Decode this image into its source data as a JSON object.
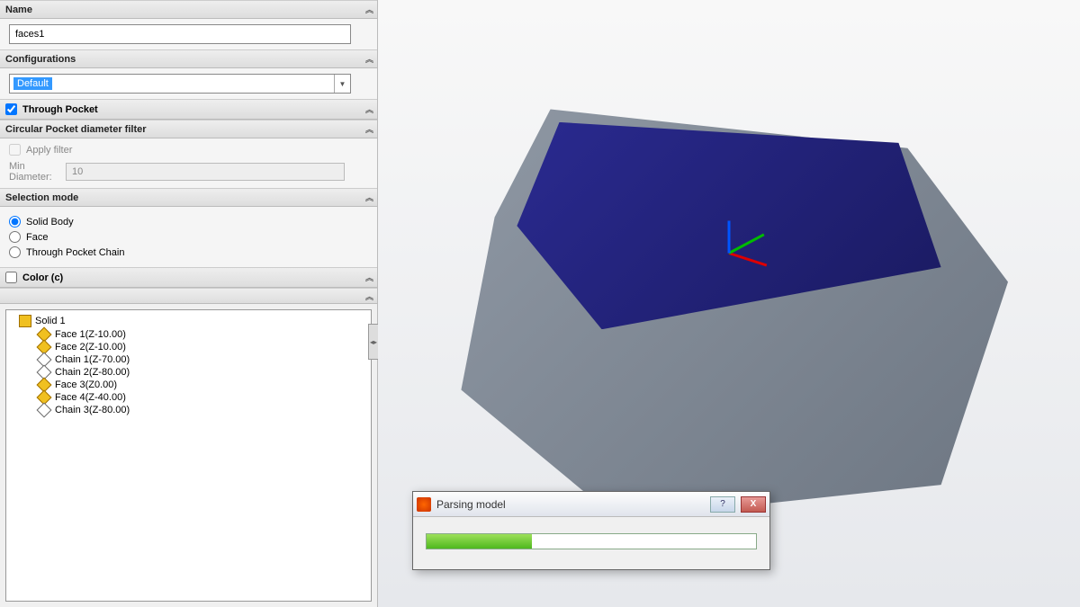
{
  "panel": {
    "name_label": "Name",
    "name_value": "faces1",
    "config_label": "Configurations",
    "config_value": "Default",
    "through_pocket": "Through Pocket",
    "cp_filter_label": "Circular Pocket diameter filter",
    "apply_filter": "Apply filter",
    "min_label": "Min Diameter:",
    "min_value": "10",
    "selmode_label": "Selection mode",
    "radio_solid": "Solid Body",
    "radio_face": "Face",
    "radio_chain": "Through Pocket Chain",
    "color_label": "Color (c)"
  },
  "tree": {
    "root": "Solid 1",
    "items": [
      {
        "type": "face",
        "label": "Face 1(Z-10.00)"
      },
      {
        "type": "face",
        "label": "Face 2(Z-10.00)"
      },
      {
        "type": "chain",
        "label": "Chain 1(Z-70.00)"
      },
      {
        "type": "chain",
        "label": "Chain 2(Z-80.00)"
      },
      {
        "type": "face",
        "label": "Face 3(Z0.00)"
      },
      {
        "type": "face",
        "label": "Face 4(Z-40.00)"
      },
      {
        "type": "chain",
        "label": "Chain 3(Z-80.00)"
      }
    ]
  },
  "dialog": {
    "title": "Parsing model",
    "help": "?",
    "close": "X"
  }
}
